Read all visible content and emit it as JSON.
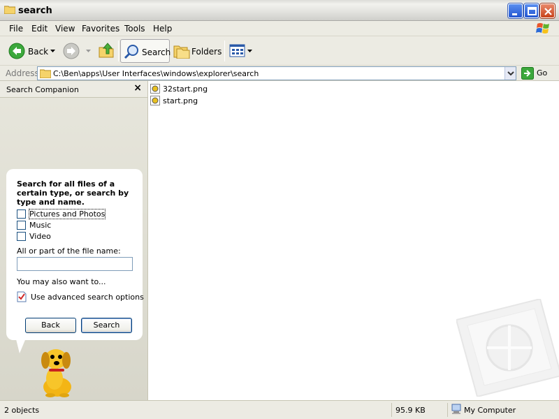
{
  "window": {
    "title": "search"
  },
  "menu": [
    {
      "label": "File"
    },
    {
      "label": "Edit"
    },
    {
      "label": "View"
    },
    {
      "label": "Favorites"
    },
    {
      "label": "Tools"
    },
    {
      "label": "Help"
    }
  ],
  "toolbar": {
    "back_label": "Back",
    "search_label": "Search",
    "folders_label": "Folders"
  },
  "address": {
    "label": "Address",
    "path": "C:\\Ben\\apps\\User Interfaces\\windows\\explorer\\search",
    "go_label": "Go"
  },
  "companion": {
    "title": "Search Companion",
    "heading": "Search for all files of a certain type, or search by type and name.",
    "options": [
      {
        "label": "Pictures and Photos",
        "checked": false
      },
      {
        "label": "Music",
        "checked": false
      },
      {
        "label": "Video",
        "checked": false
      }
    ],
    "filename_label": "All or part of the file name:",
    "filename_value": "",
    "also_label": "You may also want to...",
    "advanced_label": "Use advanced search options",
    "back_button": "Back",
    "search_button": "Search"
  },
  "files": [
    {
      "name": "32start.png"
    },
    {
      "name": "start.png"
    }
  ],
  "status": {
    "objects": "2 objects",
    "size": "95.9 KB",
    "location": "My Computer"
  },
  "colors": {
    "title_button": "#2355d0",
    "close_button": "#c8421a",
    "chrome": "#ecebe3",
    "folder": "#f5d36a"
  }
}
